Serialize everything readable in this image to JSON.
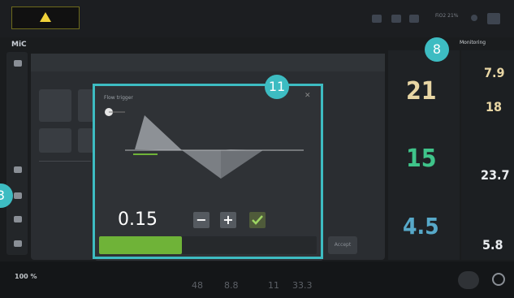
{
  "top_bar": {
    "alarm_icon": "warning-triangle-icon",
    "status_text": "FiO2 21%",
    "monitoring_label": "Monitoring"
  },
  "mode": "MiC",
  "badges": {
    "popup_callout": "11",
    "monitoring_callout": "8",
    "left_callout": "3"
  },
  "popup": {
    "title": "Flow trigger",
    "value": "0.15",
    "minus_label": "−",
    "plus_label": "+",
    "confirm_icon": "checkmark-icon",
    "close_icon": "close-icon",
    "slider_fraction": 0.38,
    "ok_label": "Accept"
  },
  "right_panel": {
    "main_values": [
      {
        "value": "21",
        "color": "#e8d6a4"
      },
      {
        "value": "15",
        "color": "#3fc48a"
      },
      {
        "value": "4.5",
        "color": "#57a9c9"
      }
    ],
    "side_values": [
      {
        "value": "7.9",
        "color": "#e8d6a4"
      },
      {
        "value": "18",
        "color": "#e8d6a4"
      },
      {
        "value": "23.7",
        "color": "#e9ecef"
      },
      {
        "value": "5.8",
        "color": "#e9ecef"
      }
    ]
  },
  "bottom_bar": {
    "o2_value": "100 %",
    "values": [
      "48",
      "8.8",
      "11",
      "33.3"
    ]
  },
  "colors": {
    "accent": "#3dbcc2",
    "slider_green": "#6fb338",
    "alarm_yellow": "#f0d23a"
  }
}
